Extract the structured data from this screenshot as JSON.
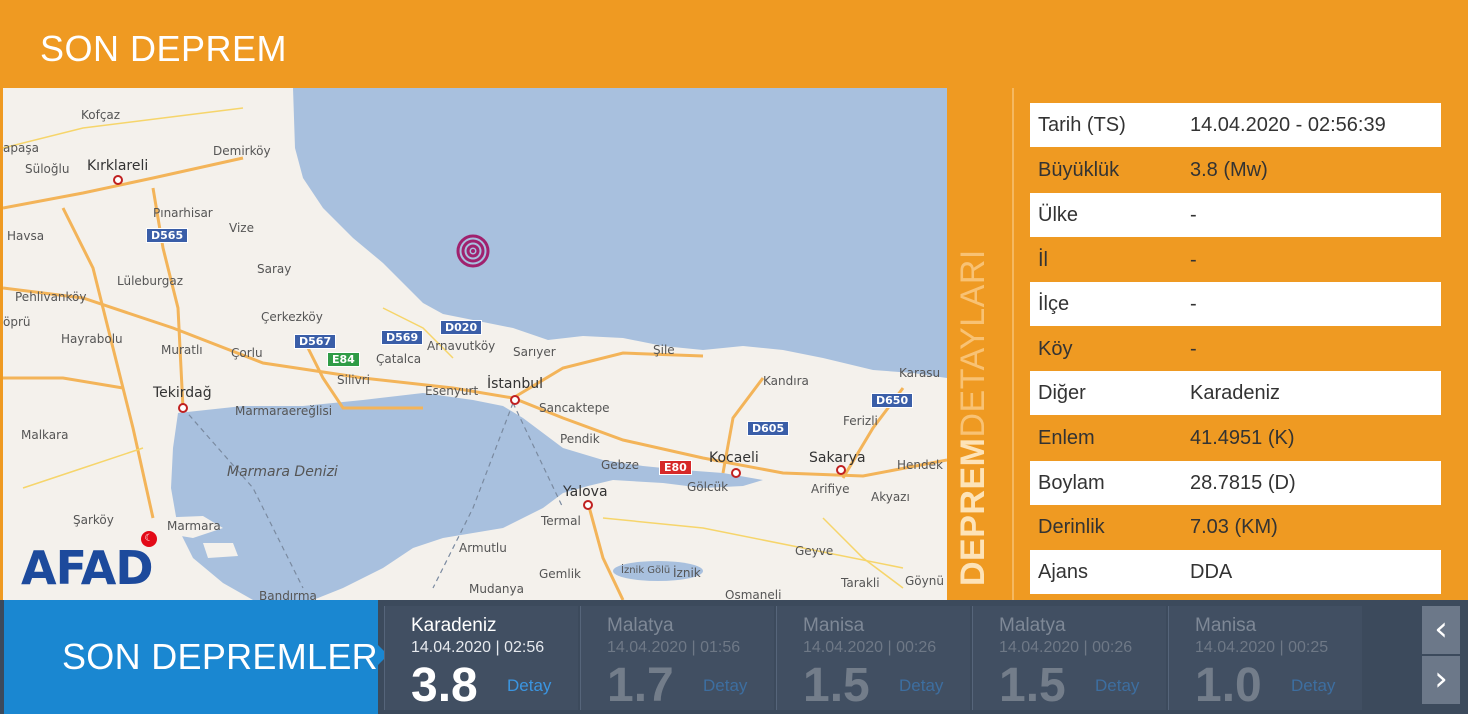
{
  "header": {
    "title": "SON DEPREM"
  },
  "side_heading": {
    "bold": "DEPREM",
    "light": "DETAYLARI"
  },
  "details": [
    {
      "label": "Tarih (TS)",
      "value": "14.04.2020 - 02:56:39"
    },
    {
      "label": "Büyüklük",
      "value": "3.8 (Mw)"
    },
    {
      "label": "Ülke",
      "value": "-"
    },
    {
      "label": "İl",
      "value": "-"
    },
    {
      "label": "İlçe",
      "value": "-"
    },
    {
      "label": "Köy",
      "value": "-"
    },
    {
      "label": "Diğer",
      "value": "Karadeniz"
    },
    {
      "label": "Enlem",
      "value": "41.4951 (K)"
    },
    {
      "label": "Boylam",
      "value": "28.7815 (D)"
    },
    {
      "label": "Derinlik",
      "value": "7.03 (KM)"
    },
    {
      "label": "Ajans",
      "value": "DDA"
    }
  ],
  "map": {
    "logo": "AFAD",
    "places": [
      "Kofçaz",
      "Demirköy",
      "Kırklareli",
      "apaşa",
      "Süloğlu",
      "Pınarhisar",
      "Vize",
      "Havsa",
      "Saray",
      "Lüleburgaz",
      "Pehlivanköy",
      "öprü",
      "Çerkezköy",
      "Hayrabolu",
      "Muratlı",
      "Çorlu",
      "Çatalca",
      "Arnavutköy",
      "Sarıyer",
      "Şile",
      "Silivri",
      "Esenyurt",
      "İstanbul",
      "Sancaktepe",
      "Kandıra",
      "Karasu",
      "Tekirdağ",
      "Marmaraereğlisi",
      "Ferizli",
      "Malkara",
      "Pendik",
      "Marmara Denizi",
      "Gebze",
      "Kocaeli",
      "Sakarya",
      "Hendek",
      "Gölcük",
      "Arifiye",
      "Akyazı",
      "Yalova",
      "Şarköy",
      "Marmara",
      "Termal",
      "Armutlu",
      "Geyve",
      "Gemlik",
      "İznik Gölü",
      "İznik",
      "Mudanya",
      "Tarakli",
      "Göynü",
      "Osmaneli",
      "Bandırma"
    ],
    "roads": [
      "D565",
      "D020",
      "D569",
      "D567",
      "E84",
      "D650",
      "D605",
      "E80"
    ]
  },
  "bottom": {
    "title": "SON DEPREMLER",
    "detail_label": "Detay",
    "nav_prev": "‹",
    "nav_next": "›",
    "quakes": [
      {
        "place": "Karadeniz",
        "datetime": "14.04.2020 | 02:56",
        "magnitude": "3.8"
      },
      {
        "place": "Malatya",
        "datetime": "14.04.2020 | 01:56",
        "magnitude": "1.7"
      },
      {
        "place": "Manisa",
        "datetime": "14.04.2020 | 00:26",
        "magnitude": "1.5"
      },
      {
        "place": "Malatya",
        "datetime": "14.04.2020 | 00:26",
        "magnitude": "1.5"
      },
      {
        "place": "Manisa",
        "datetime": "14.04.2020 | 00:25",
        "magnitude": "1.0"
      }
    ]
  },
  "colors": {
    "orange": "#ef9a22",
    "blue": "#1a87d1",
    "dark": "#3c4a5c",
    "epicenter": "#a0216e"
  }
}
